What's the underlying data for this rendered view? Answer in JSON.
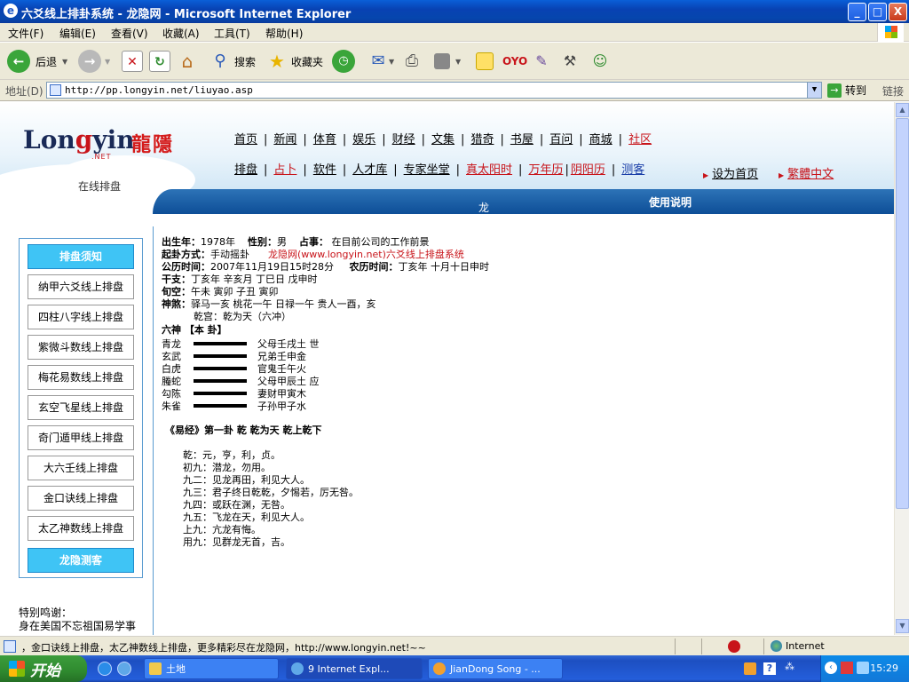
{
  "window": {
    "title": "六爻线上排卦系统 - 龙隐网 - Microsoft Internet Explorer",
    "controls": {
      "minimize": "_",
      "maximize": "□",
      "close": "X"
    }
  },
  "menu": [
    "文件(F)",
    "编辑(E)",
    "查看(V)",
    "收藏(A)",
    "工具(T)",
    "帮助(H)"
  ],
  "toolbar": {
    "back": "后退",
    "search": "搜索",
    "favorites": "收藏夹"
  },
  "address": {
    "label": "地址(D)",
    "url": "http://pp.longyin.net/liuyao.asp",
    "go": "转到",
    "links": "链接"
  },
  "site": {
    "logo_en_1": "Lon",
    "logo_en_y": "g",
    "logo_en_2": "yin",
    "logo_net": ".NET",
    "logo_cn": "龍隱",
    "slogan": "在线排盘",
    "nav_row1": [
      "首页",
      "新闻",
      "体育",
      "娱乐",
      "财经",
      "文集",
      "猎奇",
      "书屋",
      "百问",
      "商城",
      "社区"
    ],
    "nav_row2": [
      "排盘",
      "占卜",
      "软件",
      "人才库",
      "专家坐堂",
      "真太阳时",
      "万年历",
      "阴阳历",
      "测客"
    ],
    "set_home": "设为首页",
    "traditional": "繁體中文",
    "banner_prefix": "龙隐在线排盘",
    "banner_bold": "使用说明"
  },
  "sidebar": {
    "items": [
      "排盘须知",
      "纳甲六爻线上排盘",
      "四柱八字线上排盘",
      "紫微斗数线上排盘",
      "梅花易数线上排盘",
      "玄空飞星线上排盘",
      "奇门遁甲线上排盘",
      "大六壬线上排盘",
      "金口诀线上排盘",
      "太乙神数线上排盘",
      "龙隐测客"
    ],
    "thanks_title": "特别鸣谢：",
    "thanks_text": "身在美国不忘祖国易学事"
  },
  "result": {
    "birth_label": "出生年：",
    "birth_value": "1978年",
    "gender_label": "性别：",
    "gender_value": "男",
    "matter_label": "占事：",
    "matter_value": "在目前公司的工作前景",
    "method_label": "起卦方式：",
    "method_value": "手动摇卦",
    "method_link": "龙隐网(www.longyin.net)六爻线上排盘系统",
    "solar_label": "公历时间：",
    "solar_value": "2007年11月19日15时28分",
    "lunar_label": "农历时间：",
    "lunar_value": "丁亥年 十月十日申时",
    "ganzhi_label": "干支：",
    "ganzhi_value": "丁亥年 辛亥月 丁巳日 戊申时",
    "xunkong_label": "旬空：",
    "xunkong_value": "午未   寅卯   子丑   寅卯",
    "shensha_label": "神煞：",
    "shensha_value": "驿马一亥   桃花一午   日禄一午   贵人一酉，亥",
    "palace": "乾宫：乾为天（六冲）",
    "liushen_header": "六神  【本     卦】",
    "yao": [
      {
        "god": "青龙",
        "text": "父母壬戌土   世"
      },
      {
        "god": "玄武",
        "text": "兄弟壬申金"
      },
      {
        "god": "白虎",
        "text": "官鬼壬午火"
      },
      {
        "god": "螣蛇",
        "text": "父母甲辰土   应"
      },
      {
        "god": "勾陈",
        "text": "妻财甲寅木"
      },
      {
        "god": "朱雀",
        "text": "子孙甲子水"
      }
    ],
    "yijing_title": "《易经》第一卦 乾 乾为天 乾上乾下",
    "yijing_lines": [
      "乾：元，亨，利，贞。",
      "初九：潜龙，勿用。",
      "九二：见龙再田，利见大人。",
      "九三：君子终日乾乾，夕惕若，厉无咎。",
      "九四：或跃在渊，无咎。",
      "九五：飞龙在天，利见大人。",
      "上九：亢龙有悔。",
      "用九：见群龙无首，吉。"
    ]
  },
  "status": {
    "text": "，金口诀线上排盘，太乙神数线上排盘，更多精彩尽在龙隐网，http://www.longyin.net!~~",
    "zone": "Internet"
  },
  "taskbar": {
    "start": "开始",
    "tasks": [
      "土地",
      "9 Internet Expl...",
      "JianDong Song - ..."
    ],
    "clock": "15:29"
  }
}
